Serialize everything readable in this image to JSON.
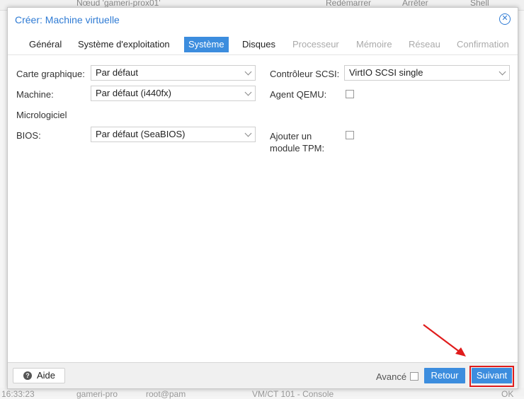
{
  "background": {
    "top_node": "Nœud 'gameri-prox01'",
    "top_restart": "Redémarrer",
    "top_stop": "Arrêter",
    "top_shell": "Shell",
    "bottom_time": "16:33:23",
    "bottom_node": "gameri-pro",
    "bottom_user": "root@pam",
    "bottom_task": "VM/CT 101 - Console",
    "bottom_status": "OK"
  },
  "dialog": {
    "title": "Créer: Machine virtuelle",
    "tabs": [
      {
        "label": "Général",
        "state": "normal"
      },
      {
        "label": "Système d'exploitation",
        "state": "normal"
      },
      {
        "label": "Système",
        "state": "active"
      },
      {
        "label": "Disques",
        "state": "normal"
      },
      {
        "label": "Processeur",
        "state": "disabled"
      },
      {
        "label": "Mémoire",
        "state": "disabled"
      },
      {
        "label": "Réseau",
        "state": "disabled"
      },
      {
        "label": "Confirmation",
        "state": "disabled"
      }
    ],
    "form": {
      "graphics_label": "Carte graphique:",
      "graphics_value": "Par défaut",
      "machine_label": "Machine:",
      "machine_value": "Par défaut (i440fx)",
      "firmware_heading": "Micrologiciel",
      "bios_label": "BIOS:",
      "bios_value": "Par défaut (SeaBIOS)",
      "scsi_label": "Contrôleur SCSI:",
      "scsi_value": "VirtIO SCSI single",
      "qemu_agent_label": "Agent QEMU:",
      "qemu_agent_checked": false,
      "tpm_label_line1": "Ajouter un",
      "tpm_label_line2": "module TPM:",
      "tpm_checked": false
    },
    "footer": {
      "help_label": "Aide",
      "advanced_label": "Avancé",
      "advanced_checked": false,
      "back_label": "Retour",
      "next_label": "Suivant"
    }
  },
  "colors": {
    "accent": "#3c8dde",
    "title": "#2f7bd4",
    "highlight": "#e01c1c"
  }
}
